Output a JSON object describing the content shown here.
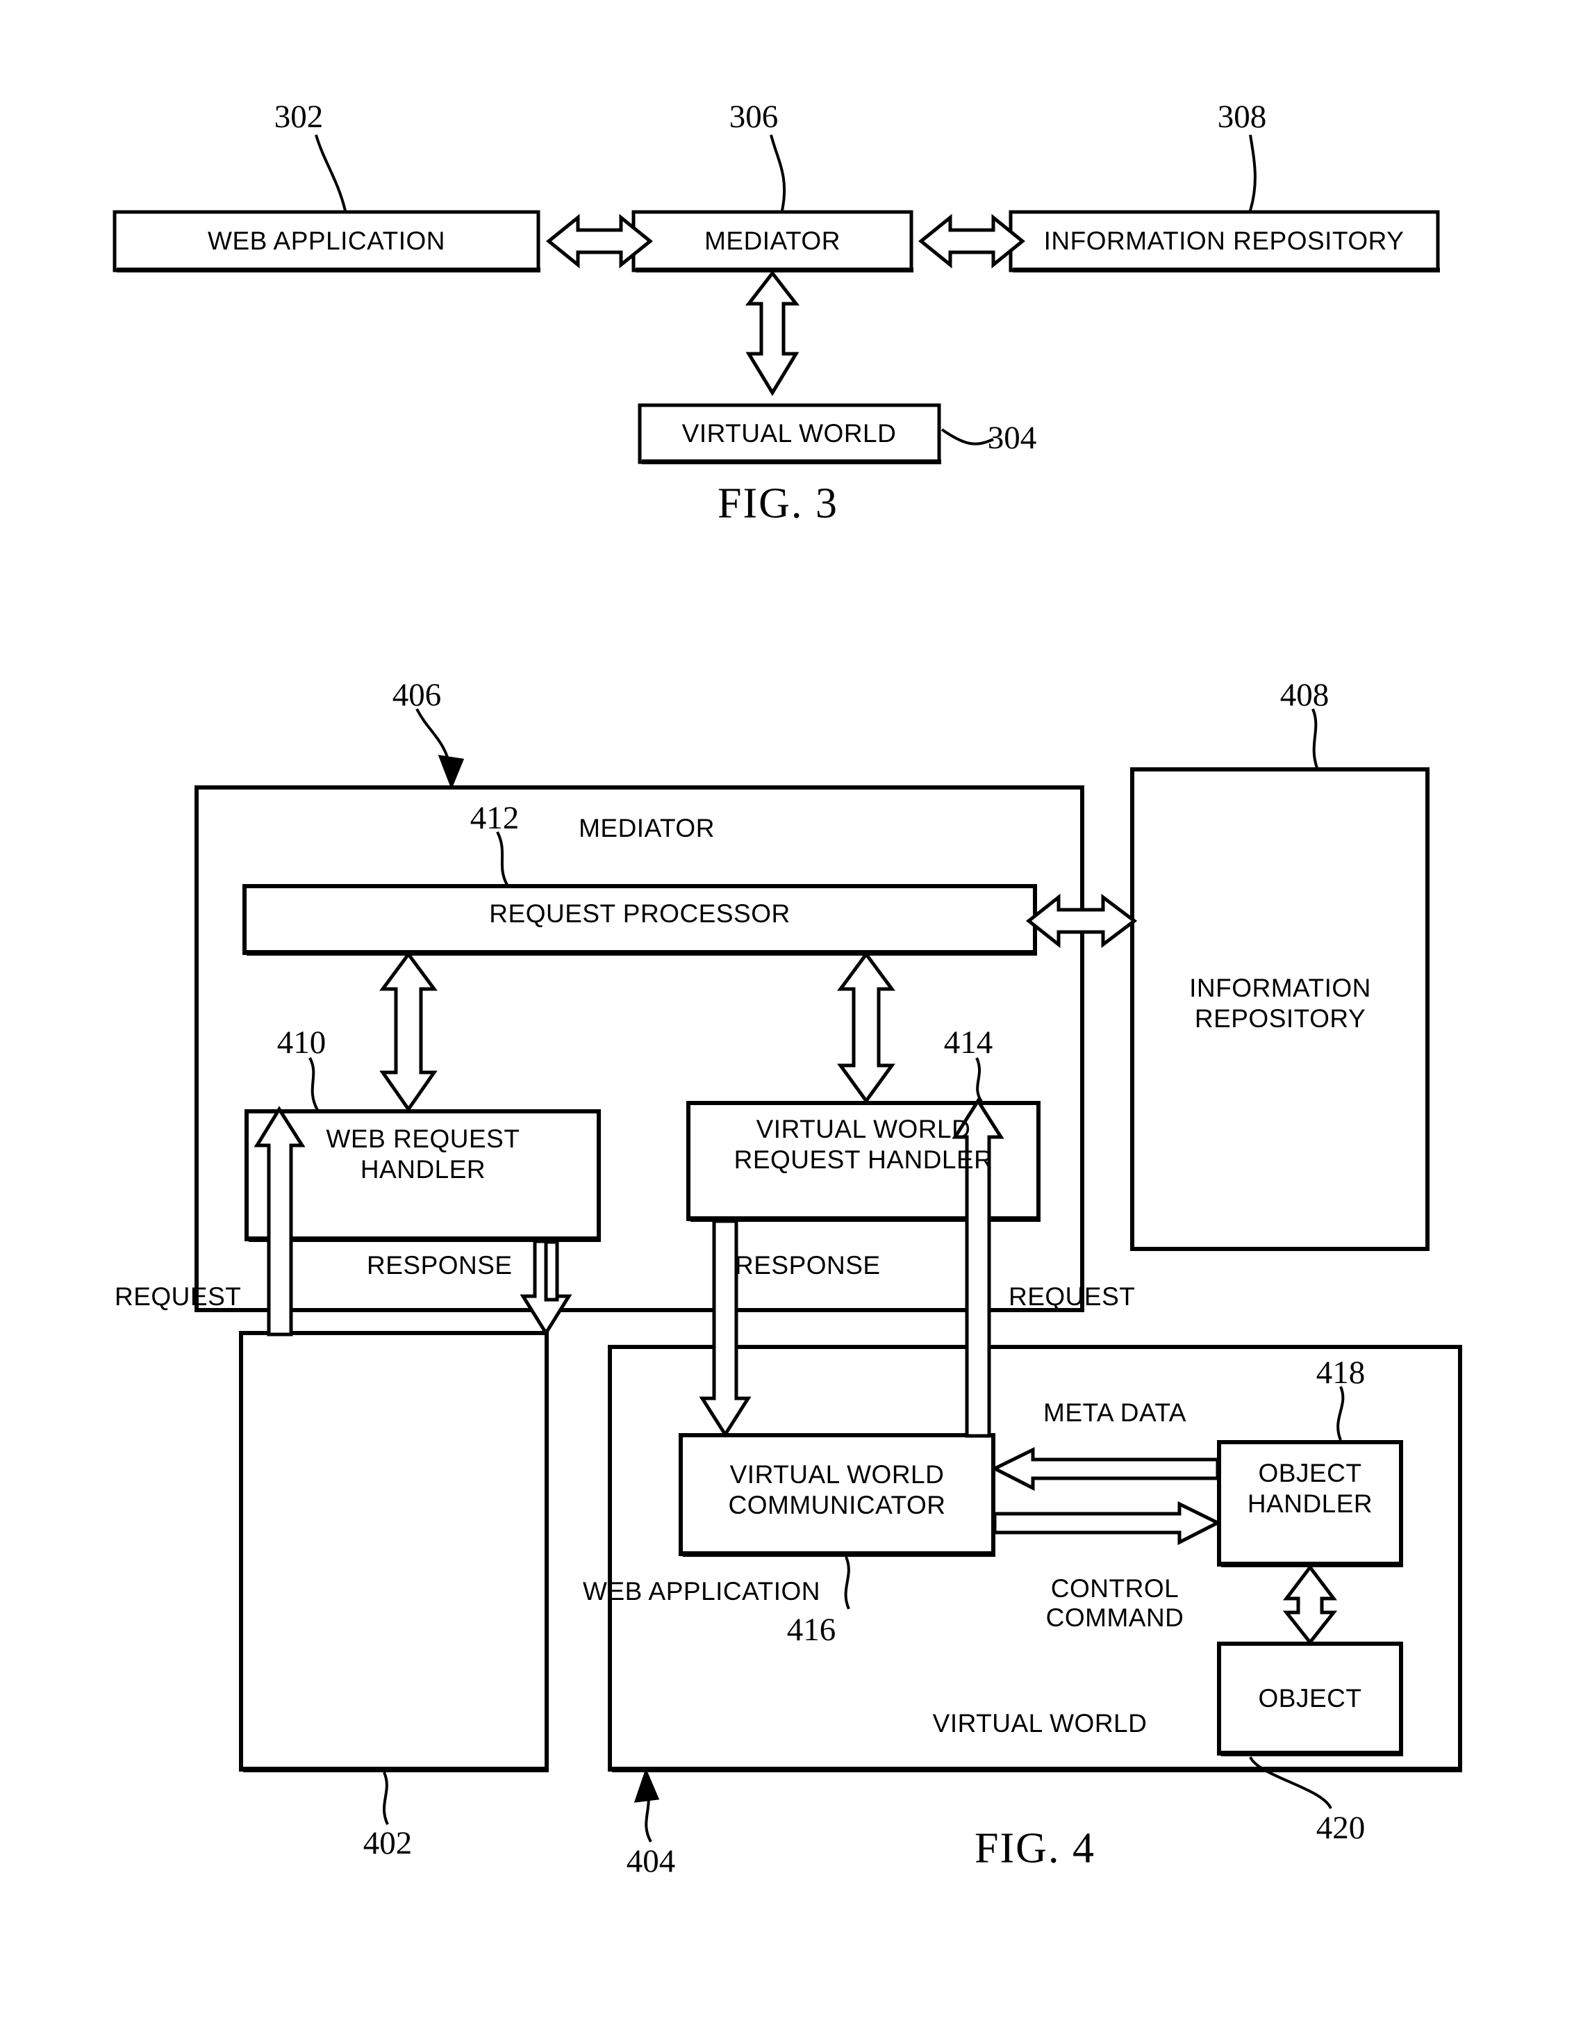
{
  "document": {
    "type": "patent-drawing-sheet",
    "figures": [
      "FIG. 3",
      "FIG. 4"
    ]
  },
  "fig3": {
    "caption": "FIG. 3",
    "boxes": [
      {
        "id": "web-application",
        "label": "WEB APPLICATION",
        "ref": "302"
      },
      {
        "id": "mediator",
        "label": "MEDIATOR",
        "ref": "306"
      },
      {
        "id": "information-repository",
        "label": "INFORMATION REPOSITORY",
        "ref": "308"
      },
      {
        "id": "virtual-world",
        "label": "VIRTUAL WORLD",
        "ref": "304"
      }
    ],
    "connectors": [
      {
        "from": "web-application",
        "to": "mediator",
        "style": "double-headed-open-arrow"
      },
      {
        "from": "mediator",
        "to": "information-repository",
        "style": "double-headed-open-arrow"
      },
      {
        "from": "mediator",
        "to": "virtual-world",
        "style": "double-headed-open-arrow"
      }
    ]
  },
  "fig4": {
    "caption": "FIG. 4",
    "containers": [
      {
        "id": "mediator",
        "label": "MEDIATOR",
        "ref": "406"
      },
      {
        "id": "virtual-world",
        "label": "VIRTUAL WORLD",
        "ref": "404"
      }
    ],
    "boxes": [
      {
        "id": "request-processor",
        "label": "REQUEST PROCESSOR",
        "ref": "412"
      },
      {
        "id": "web-request-handler",
        "label": "WEB REQUEST HANDLER",
        "line1": "WEB REQUEST",
        "line2": "HANDLER",
        "ref": "410"
      },
      {
        "id": "virtual-world-request-handler",
        "label": "VIRTUAL WORLD REQUEST HANDLER",
        "line1": "VIRTUAL WORLD",
        "line2": "REQUEST HANDLER",
        "ref": "414"
      },
      {
        "id": "information-repository",
        "label": "INFORMATION REPOSITORY",
        "line1": "INFORMATION",
        "line2": "REPOSITORY",
        "ref": "408"
      },
      {
        "id": "web-application",
        "label": "WEB APPLICATION",
        "ref": "402"
      },
      {
        "id": "virtual-world-communicator",
        "label": "VIRTUAL WORLD COMMUNICATOR",
        "line1": "VIRTUAL WORLD",
        "line2": "COMMUNICATOR",
        "ref": "416"
      },
      {
        "id": "object-handler",
        "label": "OBJECT HANDLER",
        "line1": "OBJECT",
        "line2": "HANDLER",
        "ref": "418"
      },
      {
        "id": "object",
        "label": "OBJECT",
        "ref": "420"
      }
    ],
    "flow_labels": {
      "request_left": "REQUEST",
      "response_left": "RESPONSE",
      "response_right": "RESPONSE",
      "request_right": "REQUEST",
      "meta_data": "META DATA",
      "control_command_line1": "CONTROL",
      "control_command_line2": "COMMAND"
    }
  },
  "style": {
    "stroke": "#000000",
    "background": "#ffffff"
  }
}
